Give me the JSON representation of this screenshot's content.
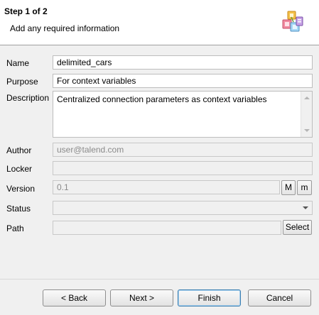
{
  "header": {
    "step_title": "Step 1 of 2",
    "subtitle": "Add any required information",
    "icon": "wizard-properties-icon"
  },
  "form": {
    "name": {
      "label": "Name",
      "value": "delimited_cars"
    },
    "purpose": {
      "label": "Purpose",
      "value": "For context variables"
    },
    "description": {
      "label": "Description",
      "value": "Centralized connection parameters as context variables"
    },
    "author": {
      "label": "Author",
      "value": "user@talend.com"
    },
    "locker": {
      "label": "Locker",
      "value": ""
    },
    "version": {
      "label": "Version",
      "value": "0.1",
      "major_label": "M",
      "minor_label": "m"
    },
    "status": {
      "label": "Status",
      "value": ""
    },
    "path": {
      "label": "Path",
      "value": "",
      "select_label": "Select"
    }
  },
  "footer": {
    "back_label": "< Back",
    "next_label": "Next >",
    "finish_label": "Finish",
    "cancel_label": "Cancel"
  },
  "colors": {
    "default_button_border": "#3c7fb1",
    "disabled_field_bg": "#f0f0f0"
  }
}
